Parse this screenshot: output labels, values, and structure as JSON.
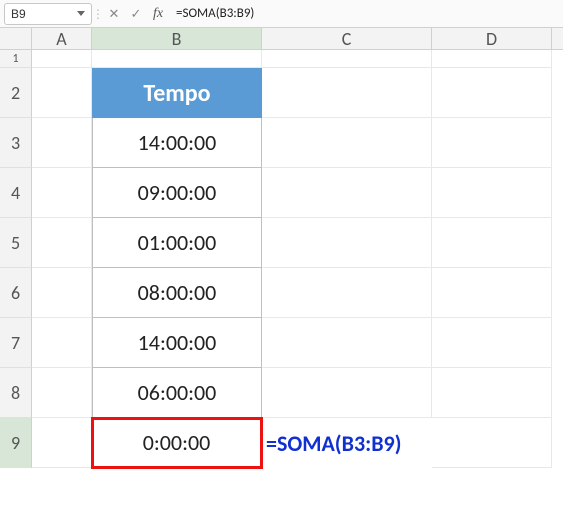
{
  "formula_bar": {
    "name_box": "B9",
    "formula": "=SOMA(B3:B9)"
  },
  "columns": {
    "A": "A",
    "B": "B",
    "C": "C",
    "D": "D"
  },
  "row_labels": {
    "r1": "1",
    "r2": "2",
    "r3": "3",
    "r4": "4",
    "r5": "5",
    "r6": "6",
    "r7": "7",
    "r8": "8",
    "r9": "9"
  },
  "table": {
    "header": "Tempo",
    "cells": {
      "b3": "14:00:00",
      "b4": "09:00:00",
      "b5": "01:00:00",
      "b6": "08:00:00",
      "b7": "14:00:00",
      "b8": "06:00:00",
      "b9": "0:00:00"
    }
  },
  "annotation": "=SOMA(B3:B9)",
  "icons": {
    "cancel": "✕",
    "accept": "✓",
    "fx": "fx"
  }
}
